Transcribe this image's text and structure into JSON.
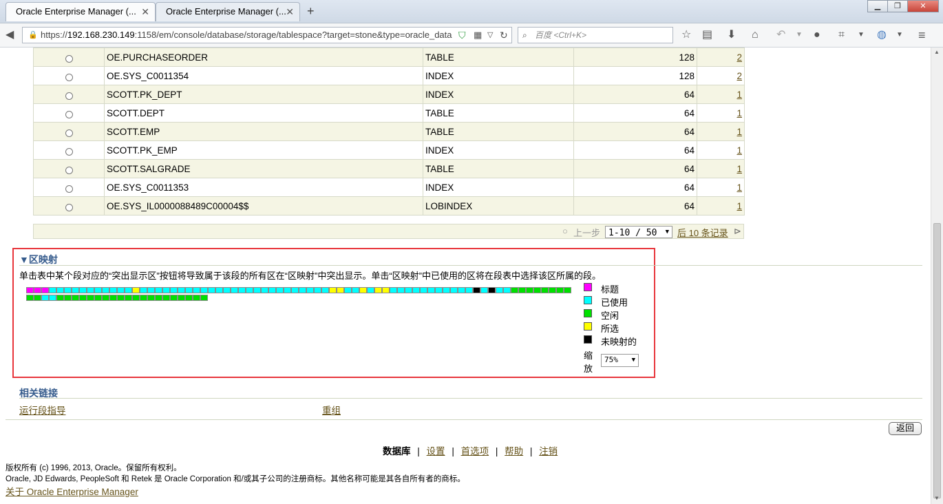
{
  "browser": {
    "tabs": [
      {
        "label": "Oracle Enterprise Manager (...",
        "active": true
      },
      {
        "label": "Oracle Enterprise Manager (...",
        "active": false
      }
    ],
    "new_tab": "+",
    "url_host": "192.168.230.149",
    "url_rest": ":1158/em/console/database/storage/tablespace?target=stone&type=oracle_data",
    "url_scheme": "https://",
    "search_placeholder": "百度 <Ctrl+K>"
  },
  "segments_table": {
    "rows": [
      {
        "name": "OE.PURCHASEORDER",
        "type": "TABLE",
        "size": "128",
        "extents": "2"
      },
      {
        "name": "OE.SYS_C0011354",
        "type": "INDEX",
        "size": "128",
        "extents": "2"
      },
      {
        "name": "SCOTT.PK_DEPT",
        "type": "INDEX",
        "size": "64",
        "extents": "1"
      },
      {
        "name": "SCOTT.DEPT",
        "type": "TABLE",
        "size": "64",
        "extents": "1"
      },
      {
        "name": "SCOTT.EMP",
        "type": "TABLE",
        "size": "64",
        "extents": "1"
      },
      {
        "name": "SCOTT.PK_EMP",
        "type": "INDEX",
        "size": "64",
        "extents": "1"
      },
      {
        "name": "SCOTT.SALGRADE",
        "type": "TABLE",
        "size": "64",
        "extents": "1"
      },
      {
        "name": "OE.SYS_C0011353",
        "type": "INDEX",
        "size": "64",
        "extents": "1"
      },
      {
        "name": "OE.SYS_IL0000088489C00004$$",
        "type": "LOBINDEX",
        "size": "64",
        "extents": "1"
      }
    ],
    "pager": {
      "prev": "上一步",
      "range": "1-10 / 50",
      "next": "后 10 条记录"
    }
  },
  "extent_map": {
    "title": "区映射",
    "description": "单击表中某个段对应的“突出显示区”按钮将导致属于该段的所有区在“区映射”中突出显示。单击“区映射”中已使用的区将在段表中选择该区所属的段。",
    "colors": {
      "header": "#ff00ff",
      "used": "#00ffff",
      "free": "#00e000",
      "selected": "#ffff00",
      "unmapped": "#000000"
    },
    "row1": [
      "header",
      "header",
      "header",
      "used",
      "used",
      "used",
      "used",
      "used",
      "used",
      "used",
      "used",
      "used",
      "used",
      "used",
      "selected",
      "used",
      "used",
      "used",
      "used",
      "used",
      "used",
      "used",
      "used",
      "used",
      "used",
      "used",
      "used",
      "used",
      "used",
      "used",
      "used",
      "used",
      "used",
      "used",
      "used",
      "used",
      "used",
      "used",
      "used",
      "used",
      "selected",
      "selected",
      "used",
      "used",
      "selected",
      "used",
      "selected",
      "selected",
      "used",
      "used",
      "used",
      "used",
      "used",
      "used",
      "used",
      "used",
      "used",
      "used",
      "used",
      "unmapped",
      "used",
      "unmapped",
      "used",
      "used",
      "free",
      "free",
      "free",
      "free",
      "free",
      "free",
      "free",
      "free"
    ],
    "row2": [
      "free",
      "free",
      "used",
      "used",
      "free",
      "free",
      "free",
      "free",
      "free",
      "free",
      "free",
      "free",
      "free",
      "free",
      "free",
      "free",
      "free",
      "free",
      "free",
      "free",
      "free",
      "free",
      "free",
      "free"
    ],
    "legend": [
      {
        "key": "header",
        "label": "标题"
      },
      {
        "key": "used",
        "label": "已使用"
      },
      {
        "key": "free",
        "label": "空闲"
      },
      {
        "key": "selected",
        "label": "所选"
      },
      {
        "key": "unmapped",
        "label": "未映射的"
      }
    ],
    "zoom_label_1": "缩",
    "zoom_label_2": "放",
    "zoom_value": "75%"
  },
  "related_links": {
    "title": "相关链接",
    "links": [
      "运行段指导",
      "重组"
    ]
  },
  "return_button": "返回",
  "footer": {
    "nav": [
      "数据库",
      "设置",
      "首选项",
      "帮助",
      "注销"
    ],
    "copyright": "版权所有 (c) 1996, 2013, Oracle。保留所有权利。",
    "trademark": "Oracle, JD Edwards, PeopleSoft 和 Retek 是 Oracle Corporation 和/或其子公司的注册商标。其他名称可能是其各自所有者的商标。",
    "about": "关于 Oracle Enterprise Manager"
  }
}
